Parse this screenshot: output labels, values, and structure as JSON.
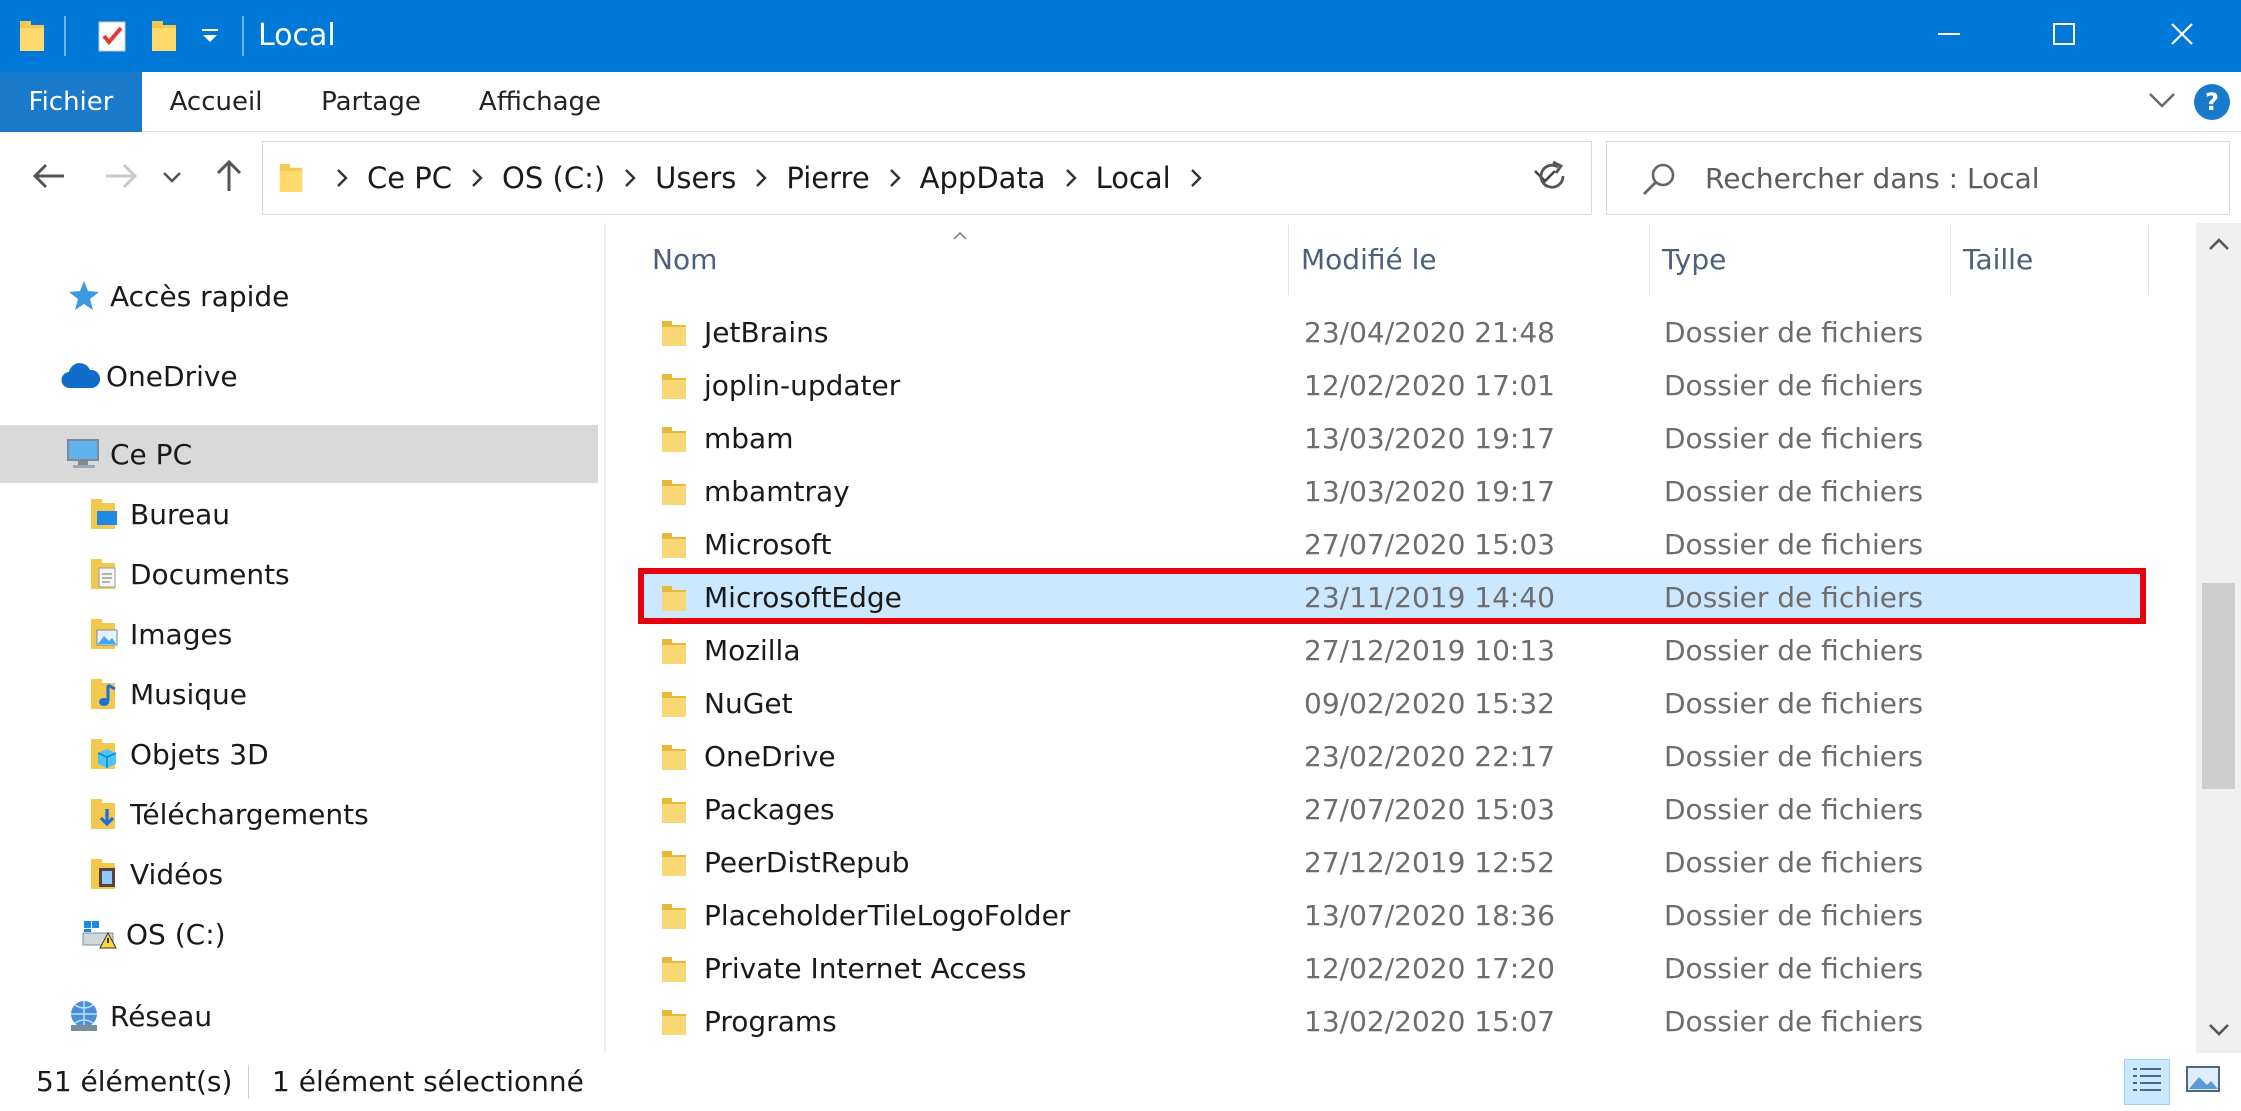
{
  "window": {
    "title": "Local",
    "quick_access_icons": [
      "folder-icon",
      "properties-checklist-icon",
      "new-folder-icon",
      "customize-dropdown-icon"
    ],
    "controls": [
      "minimize-icon",
      "maximize-icon",
      "close-icon"
    ]
  },
  "ribbon": {
    "tabs": [
      {
        "label": "Fichier"
      },
      {
        "label": "Accueil"
      },
      {
        "label": "Partage"
      },
      {
        "label": "Affichage"
      }
    ],
    "help_label": "?"
  },
  "address": {
    "breadcrumbs": [
      "Ce PC",
      "OS (C:)",
      "Users",
      "Pierre",
      "AppData",
      "Local"
    ]
  },
  "search": {
    "placeholder": "Rechercher dans : Local"
  },
  "navigation": {
    "items": [
      {
        "label": "Accès rapide",
        "icon": "star-icon"
      },
      {
        "label": "OneDrive",
        "icon": "cloud-icon"
      },
      {
        "label": "Ce PC",
        "icon": "computer-icon"
      },
      {
        "label": "Bureau",
        "icon": "desktop-folder-icon"
      },
      {
        "label": "Documents",
        "icon": "documents-folder-icon"
      },
      {
        "label": "Images",
        "icon": "pictures-folder-icon"
      },
      {
        "label": "Musique",
        "icon": "music-folder-icon"
      },
      {
        "label": "Objets 3D",
        "icon": "3d-objects-folder-icon"
      },
      {
        "label": "Téléchargements",
        "icon": "downloads-folder-icon"
      },
      {
        "label": "Vidéos",
        "icon": "videos-folder-icon"
      },
      {
        "label": "OS (C:)",
        "icon": "drive-icon"
      },
      {
        "label": "Réseau",
        "icon": "network-icon"
      }
    ],
    "selected": "Ce PC"
  },
  "columns": {
    "name": "Nom",
    "modified": "Modifié le",
    "type": "Type",
    "size": "Taille"
  },
  "files": [
    {
      "name": "JetBrains",
      "modified": "23/04/2020 21:48",
      "type": "Dossier de fichiers"
    },
    {
      "name": "joplin-updater",
      "modified": "12/02/2020 17:01",
      "type": "Dossier de fichiers"
    },
    {
      "name": "mbam",
      "modified": "13/03/2020 19:17",
      "type": "Dossier de fichiers"
    },
    {
      "name": "mbamtray",
      "modified": "13/03/2020 19:17",
      "type": "Dossier de fichiers"
    },
    {
      "name": "Microsoft",
      "modified": "27/07/2020 15:03",
      "type": "Dossier de fichiers"
    },
    {
      "name": "MicrosoftEdge",
      "modified": "23/11/2019 14:40",
      "type": "Dossier de fichiers"
    },
    {
      "name": "Mozilla",
      "modified": "27/12/2019 10:13",
      "type": "Dossier de fichiers"
    },
    {
      "name": "NuGet",
      "modified": "09/02/2020 15:32",
      "type": "Dossier de fichiers"
    },
    {
      "name": "OneDrive",
      "modified": "23/02/2020 22:17",
      "type": "Dossier de fichiers"
    },
    {
      "name": "Packages",
      "modified": "27/07/2020 15:03",
      "type": "Dossier de fichiers"
    },
    {
      "name": "PeerDistRepub",
      "modified": "27/12/2019 12:52",
      "type": "Dossier de fichiers"
    },
    {
      "name": "PlaceholderTileLogoFolder",
      "modified": "13/07/2020 18:36",
      "type": "Dossier de fichiers"
    },
    {
      "name": "Private Internet Access",
      "modified": "12/02/2020 17:20",
      "type": "Dossier de fichiers"
    },
    {
      "name": "Programs",
      "modified": "13/02/2020 15:07",
      "type": "Dossier de fichiers"
    }
  ],
  "selected_file": "MicrosoftEdge",
  "status": {
    "count": "51 élément(s)",
    "selection": "1 élément sélectionné"
  },
  "colors": {
    "titlebar": "#0078d7",
    "file_tab": "#1979ca",
    "selection": "#cce8ff",
    "highlight": "#e8000b",
    "folder": "#f8d775"
  }
}
